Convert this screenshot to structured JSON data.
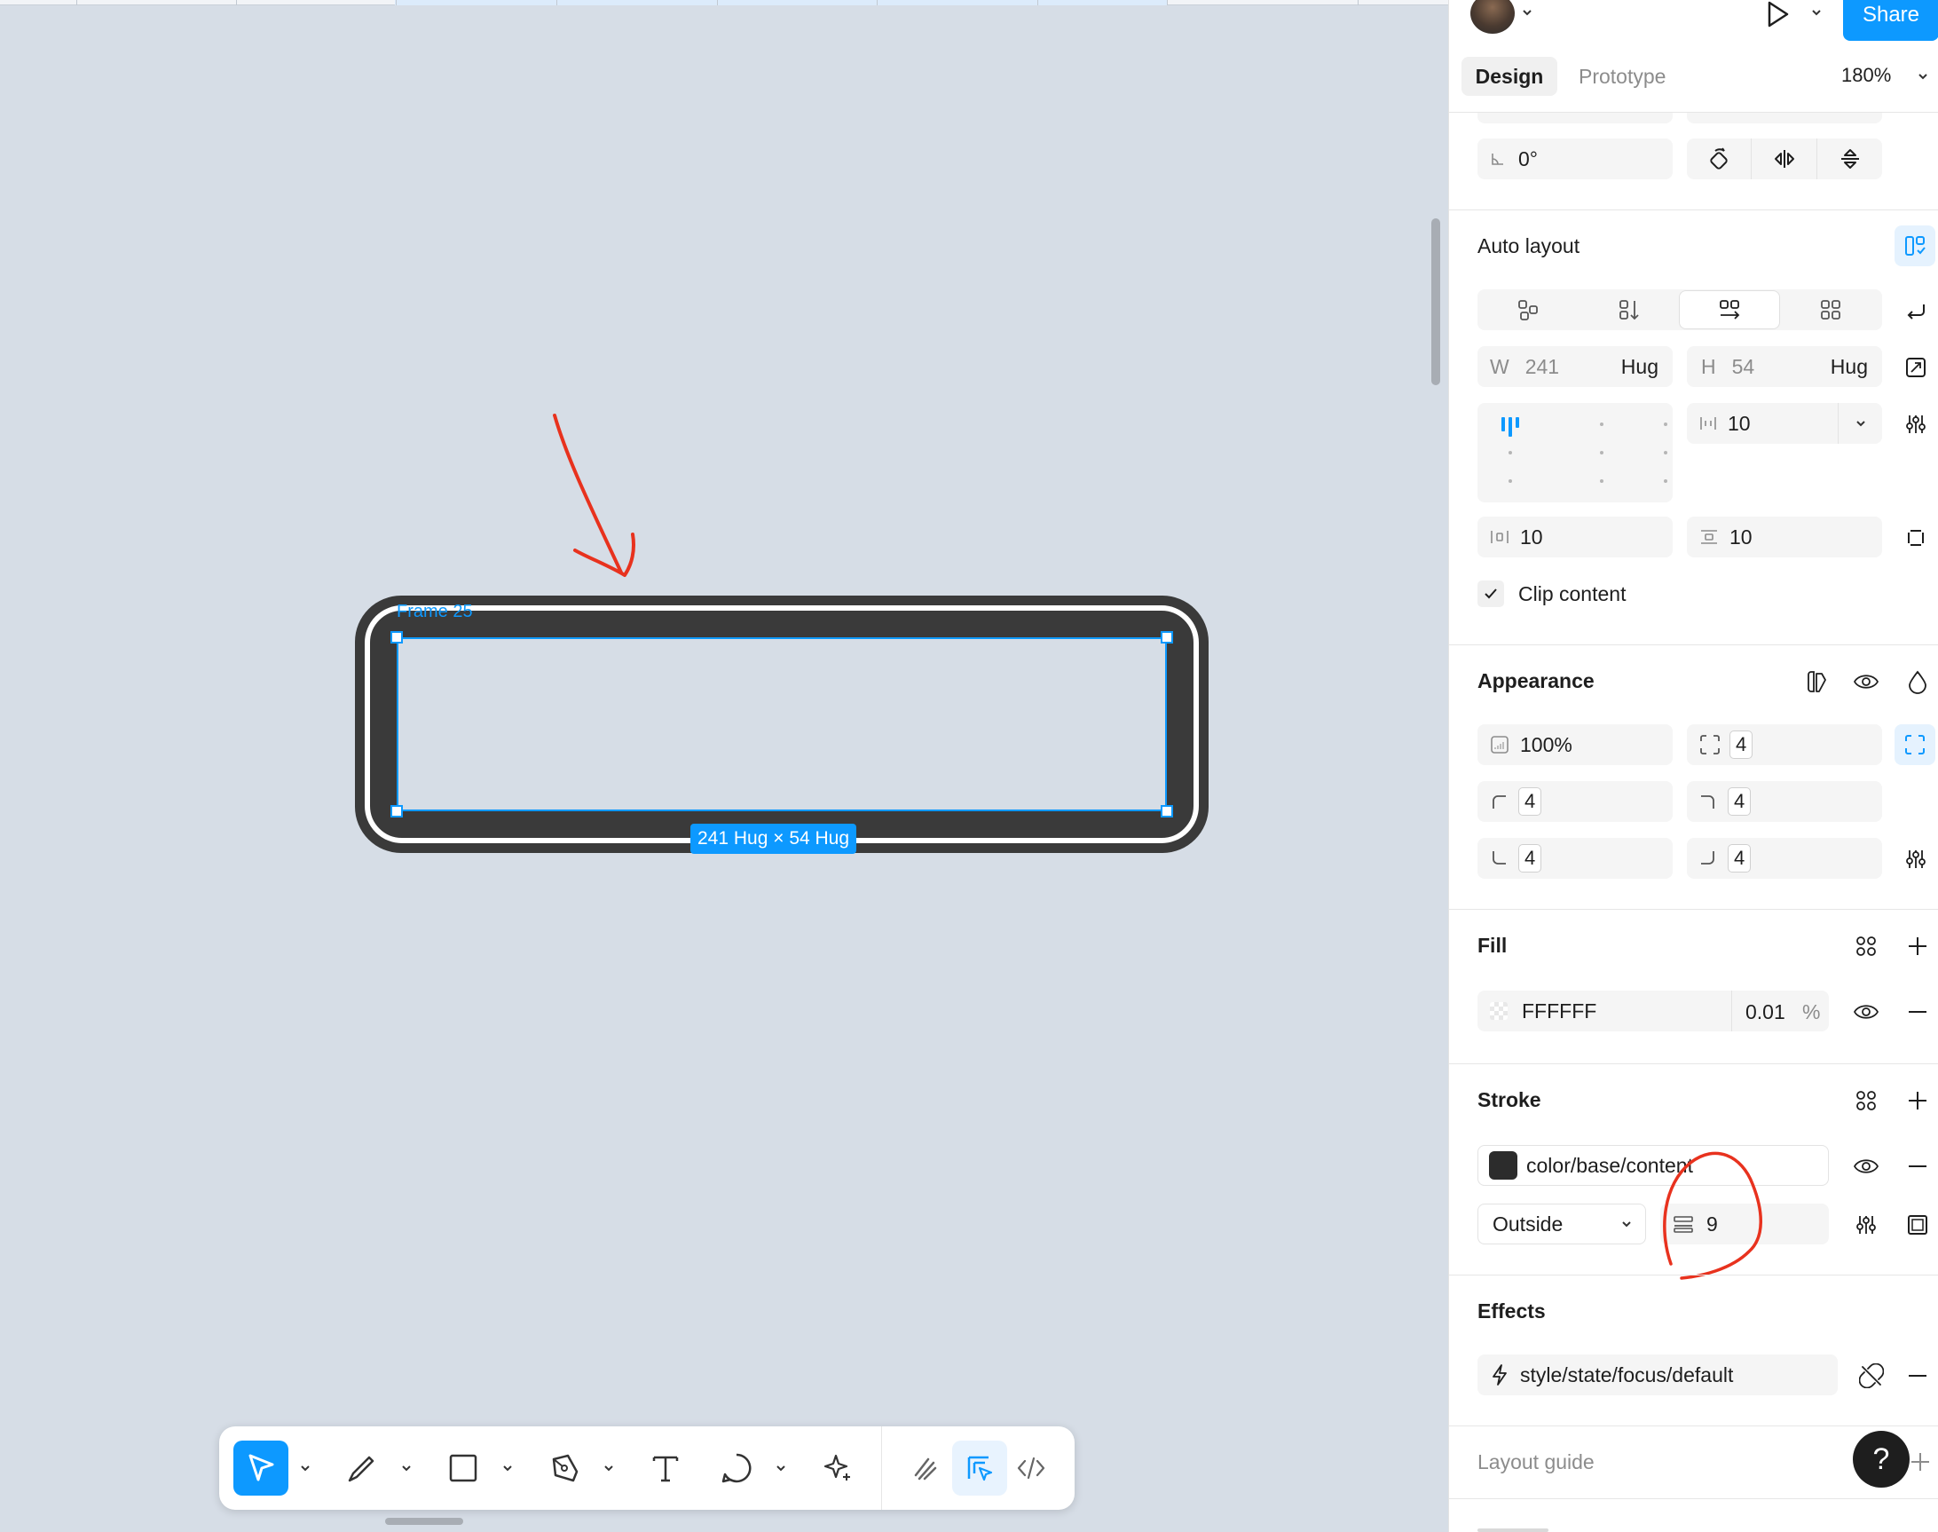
{
  "canvas": {
    "frame_name": "Frame 25",
    "dimension_badge": "241 Hug × 54 Hug"
  },
  "toolbar": {
    "tools": [
      {
        "name": "move-tool-icon",
        "active": true
      },
      {
        "name": "draw-tool-icon"
      },
      {
        "name": "rectangle-tool-icon"
      },
      {
        "name": "pen-tool-icon"
      },
      {
        "name": "text-tool-icon"
      },
      {
        "name": "comment-tool-icon"
      },
      {
        "name": "ai-actions-icon"
      },
      {
        "name": "draw-mode-icon"
      },
      {
        "name": "design-mode-icon"
      },
      {
        "name": "dev-mode-icon"
      }
    ]
  },
  "header": {
    "share_label": "Share",
    "tabs": [
      "Design",
      "Prototype"
    ],
    "active_tab": "Design",
    "zoom": "180%"
  },
  "rotation": {
    "value": "0°"
  },
  "auto_layout": {
    "title": "Auto layout",
    "width_label": "W",
    "width_value": "241",
    "width_mode": "Hug",
    "height_label": "H",
    "height_value": "54",
    "height_mode": "Hug",
    "gap": "10",
    "padding_horizontal": "10",
    "padding_vertical": "10",
    "clip_content_label": "Clip content",
    "clip_content_checked": true
  },
  "appearance": {
    "title": "Appearance",
    "opacity": "100%",
    "corner_radius": "4",
    "corner_tl": "4",
    "corner_tr": "4",
    "corner_bl": "4",
    "corner_br": "4"
  },
  "fill": {
    "title": "Fill",
    "hex": "FFFFFF",
    "opacity": "0.01",
    "opacity_unit": "%"
  },
  "stroke": {
    "title": "Stroke",
    "style_name": "color/base/content",
    "color": "#2c2c2c",
    "position": "Outside",
    "weight": "9"
  },
  "effects": {
    "title": "Effects",
    "style_name": "style/state/focus/default"
  },
  "layout_guide": {
    "title": "Layout guide"
  },
  "help": {
    "label": "?"
  },
  "colors": {
    "accent": "#0d99ff",
    "annotation": "#e8321e",
    "canvas": "#d6dde6"
  }
}
